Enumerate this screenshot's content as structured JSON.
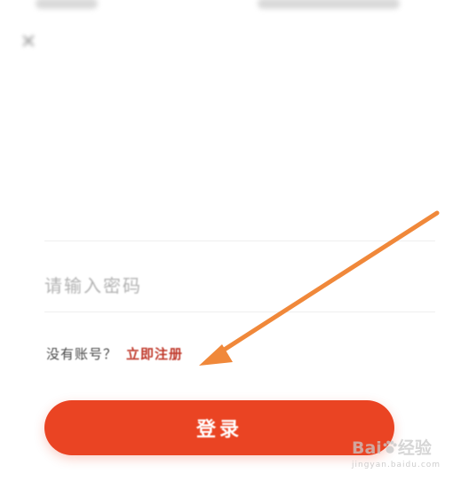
{
  "status_bar": {
    "left_text": "",
    "right_text": ""
  },
  "nav": {
    "close_icon": "close-icon",
    "right_text": ""
  },
  "header": {
    "title": "",
    "subtitle": ""
  },
  "form": {
    "account_placeholder": "",
    "password_placeholder": "请输入密码"
  },
  "register": {
    "prompt": "没有账号？",
    "link_label": "立即注册"
  },
  "forgot_label": "",
  "login_button_label": "登录",
  "annotation": {
    "arrow_color": "#f0883a"
  },
  "watermark": {
    "brand_prefix": "Bai",
    "brand_suffix": "经验",
    "subtext": "jingyan.baidu.com"
  },
  "colors": {
    "accent": "#ea4423",
    "link": "#c0392b"
  }
}
